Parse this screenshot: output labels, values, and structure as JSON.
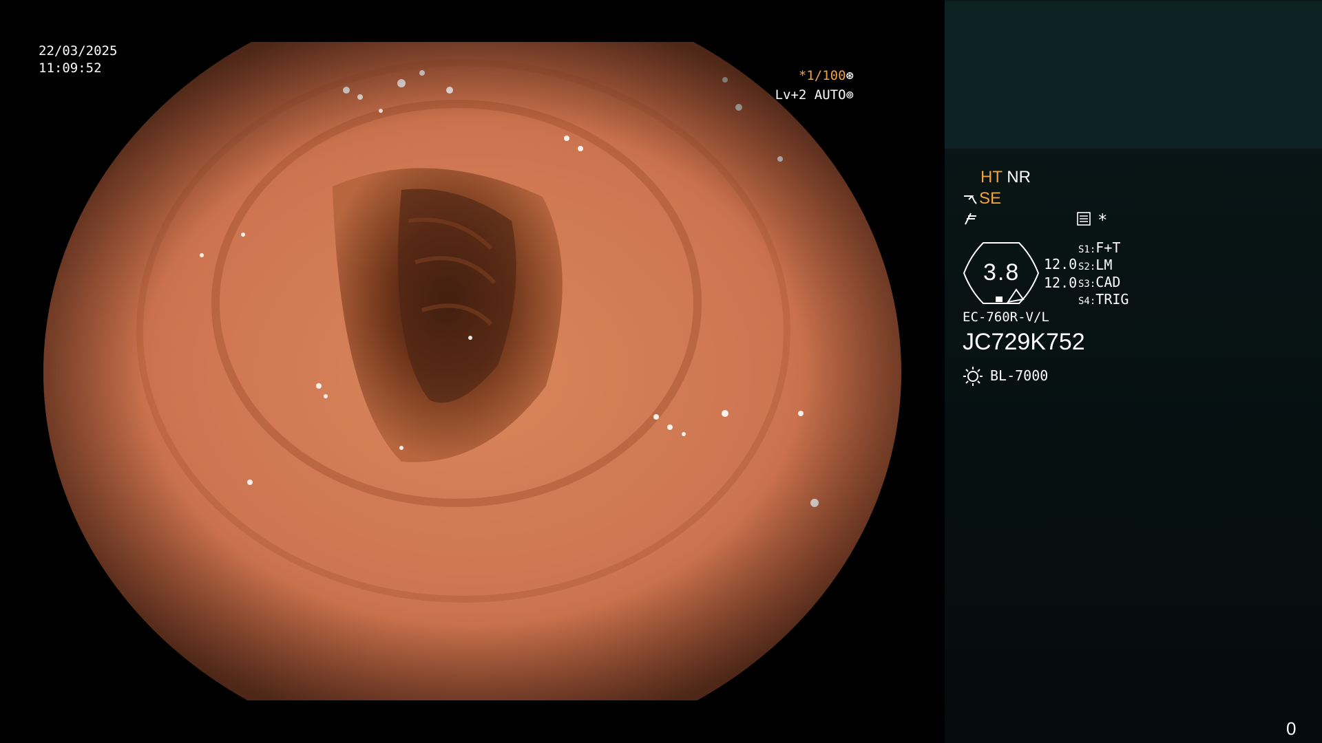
{
  "overlay": {
    "date": "22/03/2025",
    "time": "11:09:52",
    "shutter": "*1/100",
    "shutter_icon": "aperture-icon",
    "level": "Lv+2 AUTO",
    "level_icon": "iris-icon"
  },
  "panel": {
    "mode_ht": "HT",
    "mode_nr": "NR",
    "se_label": "SE",
    "asterisk": "*",
    "zoom_value": "3.8",
    "value1": "12.0",
    "value2": "12.0",
    "switches": [
      {
        "key": "S1:",
        "value": "F+T"
      },
      {
        "key": "S2:",
        "value": "LM"
      },
      {
        "key": "S3:",
        "value": "CAD"
      },
      {
        "key": "S4:",
        "value": "TRIG"
      }
    ],
    "scope_model": "EC-760R-V/L",
    "scope_serial": "JC729K752",
    "light_source": "BL-7000",
    "light_icon": "sun-icon"
  },
  "counter": "0",
  "colors": {
    "accent": "#f0a23c",
    "panel_top": "#0d2224",
    "panel": "#061011",
    "tissue": "#c8714a"
  }
}
